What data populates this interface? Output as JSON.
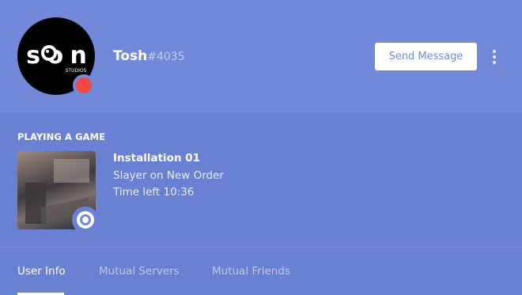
{
  "profile": {
    "username": "Tosh",
    "discriminator": "#4035",
    "avatar_logo_text": "SOON",
    "avatar_logo_subtext": "STUDIOS",
    "status_color": "#f04747",
    "send_message_label": "Send Message",
    "more_icon": "more-vertical-icon"
  },
  "activity": {
    "title": "PLAYING A GAME",
    "game_name": "Installation 01",
    "details": "Slayer on New Order",
    "state": "Time left 10:36",
    "badge_icon": "rich-presence-icon"
  },
  "tabs": [
    {
      "label": "User Info",
      "active": true
    },
    {
      "label": "Mutual Servers",
      "active": false
    },
    {
      "label": "Mutual Friends",
      "active": false
    }
  ],
  "colors": {
    "blurple": "#7289da",
    "activity_bg": "#6a80d2",
    "white": "#ffffff"
  }
}
